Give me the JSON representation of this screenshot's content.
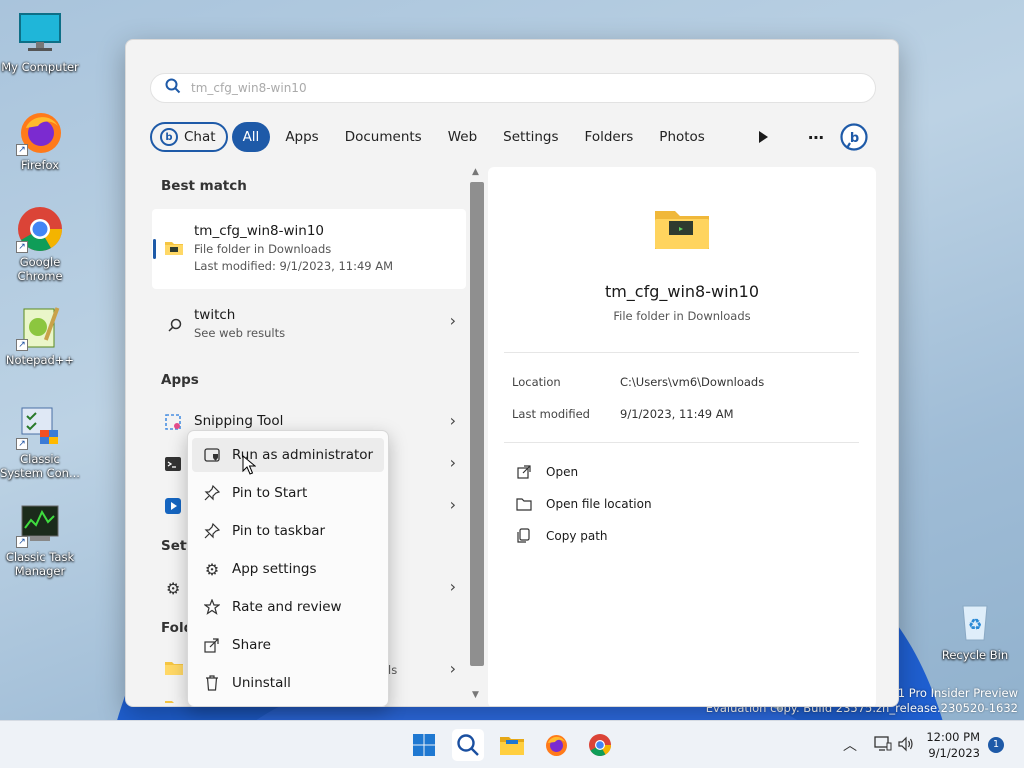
{
  "desktop": {
    "icons": [
      {
        "label": "My Computer"
      },
      {
        "label": "Firefox"
      },
      {
        "label": "Google Chrome"
      },
      {
        "label": "Notepad++"
      },
      {
        "label": "Classic System Con..."
      },
      {
        "label": "Classic Task Manager"
      },
      {
        "label": "Recycle Bin"
      }
    ],
    "watermark": {
      "line1": "11 Pro Insider Preview",
      "line2": "Evaluation copy. Build 23575.zn_release.230520-1632"
    }
  },
  "search": {
    "query": "tm_cfg_win8-win10",
    "tabs": [
      "Chat",
      "All",
      "Apps",
      "Documents",
      "Web",
      "Settings",
      "Folders",
      "Photos"
    ],
    "active_tab": "All"
  },
  "results": {
    "best_match_heading": "Best match",
    "best": {
      "title": "tm_cfg_win8-win10",
      "type": "File folder in Downloads",
      "modified": "Last modified: 9/1/2023, 11:49 AM"
    },
    "web": {
      "title": "twitch",
      "sub": "See web results"
    },
    "apps_heading": "Apps",
    "apps": [
      {
        "title": "Snipping Tool"
      }
    ],
    "settings_heading": "Sett",
    "folders_heading": "Fold",
    "folder_fragment": "ls"
  },
  "detail": {
    "name": "tm_cfg_win8-win10",
    "type": "File folder in Downloads",
    "location_label": "Location",
    "location_value": "C:\\Users\\vm6\\Downloads",
    "modified_label": "Last modified",
    "modified_value": "9/1/2023, 11:49 AM",
    "actions": [
      "Open",
      "Open file location",
      "Copy path"
    ]
  },
  "context_menu": {
    "items": [
      "Run as administrator",
      "Pin to Start",
      "Pin to taskbar",
      "App settings",
      "Rate and review",
      "Share",
      "Uninstall"
    ],
    "highlighted": "Run as administrator"
  },
  "taskbar": {
    "time": "12:00 PM",
    "date": "9/1/2023",
    "notification_count": "1"
  },
  "colors": {
    "accent": "#1e5aa8",
    "panel_bg": "#f3f3f3",
    "taskbar_bg": "#eef2f7"
  }
}
